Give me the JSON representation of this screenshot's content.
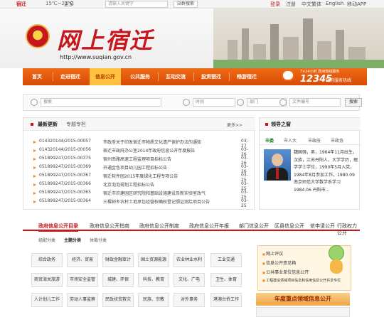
{
  "topbar": {
    "city": "宿迁",
    "weather": "15℃~21℃",
    "more": "更多",
    "search_placeholder": "请输入关键字",
    "search_button": "站群搜索",
    "links": [
      "登录",
      "注册",
      "中文繁体",
      "English",
      "移动APP"
    ]
  },
  "header": {
    "logo_text": "网上宿迁",
    "url": "http://www.suqian.gov.cn"
  },
  "nav": {
    "items": [
      "首页",
      "走进宿迁",
      "信息公开",
      "公共服务",
      "互动交流",
      "投资宿迁",
      "畅游宿迁"
    ],
    "active_index": 2,
    "hotline_label": "7×24小时 政府热线服务",
    "hotline_number": "12345",
    "hotline_sub": "政府服务热线"
  },
  "search": {
    "keyword_placeholder": "搜索",
    "time_label": "时间",
    "dept_label": "部门",
    "doc_label": "文件编号",
    "button": "搜索"
  },
  "news": {
    "tab_active": "最新更新",
    "tab_other": "专题专栏",
    "more": "更多>>",
    "rows": [
      {
        "code": "014320144/2015-00057",
        "title": "市政府关于印发宿迁市物质文化遗产保护办法的通知",
        "date": "03-27"
      },
      {
        "code": "014320144/2015-00056",
        "title": "宿迁市政府办公室2014年政府信息公开年度报告",
        "date": "03-26"
      },
      {
        "code": "051899247/2015-00375",
        "title": "宿州南路高速工程监理项目招标公告",
        "date": "03-26"
      },
      {
        "code": "051899247/2015-00369",
        "title": "开通金色项目幼儿园工程招标公告",
        "date": "03-26"
      },
      {
        "code": "051899247/2015-00367",
        "title": "宿迁软件园2015年度绿化工程专项公告",
        "date": "03-25"
      },
      {
        "code": "051899247/2015-00366",
        "title": "北京泡泡规划工程招标公告",
        "date": "03-25"
      },
      {
        "code": "051899247/2015-00365",
        "title": "宿迁市农建园区研究院和基础设施建设及新实验室改气",
        "date": "03-25"
      },
      {
        "code": "051899247/2015-00364",
        "title": "三棵树乡农村土地承包经营权确权登记颁证测绘项目公告",
        "date": "03-25"
      }
    ]
  },
  "leader": {
    "title": "领导之窗",
    "tabs": [
      "市委",
      "市人大",
      "市政府",
      "市政协"
    ],
    "active_tab": 0,
    "bio": "魏国强，男，1964年11月出生，汉族，江苏丹阳人，大学学历，理学学士学位，1990年5月入党，1984年8月参加工作。1980.09 南京师范大学数学系学习1984.06 丹阳市..."
  },
  "public": {
    "tabs": [
      "政府信息公开目录",
      "政府信息公开指南",
      "政府信息公开制度",
      "政府信息公开年报",
      "部门信息公开",
      "区县信息公开",
      "依申请公开",
      "行政权力公开"
    ],
    "active_tab": 0,
    "subtabs": [
      "组配分类",
      "主题分类",
      "体裁分类"
    ],
    "active_subtab": 1,
    "grid": [
      [
        "综合政务",
        "经济、贸易",
        "财政金融审计",
        "国土资源能源",
        "农业林业水利",
        "工业交通"
      ],
      [
        "商贸海关旅游",
        "市场安全监管",
        "城建、环保",
        "科技、教育",
        "文化、广电",
        "卫生、体育"
      ],
      [
        "人计划儿工作",
        "劳动人事监察",
        "民政扶贫救灾",
        "民族、宗教",
        "对外事务",
        "港澳台侨工作"
      ]
    ]
  },
  "sidebar": {
    "links": [
      "网上评议",
      "信息公开意见箱",
      "公共事业单位信息公开",
      "工程建设领域项目信息和信用信息公开共享专栏"
    ],
    "year_title": "年度重点领域信息公开"
  }
}
